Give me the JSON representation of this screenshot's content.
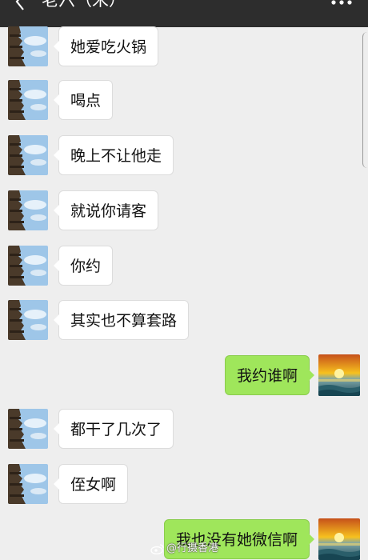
{
  "header": {
    "title": "老六（宋）",
    "back_icon": "chevron-left-icon",
    "more_icon": "more-dots-icon",
    "background": "#2d2d2d"
  },
  "messages": [
    {
      "side": "left",
      "text": "她爱吃火锅"
    },
    {
      "side": "left",
      "text": "喝点"
    },
    {
      "side": "left",
      "text": "晚上不让他走"
    },
    {
      "side": "left",
      "text": "就说你请客"
    },
    {
      "side": "left",
      "text": "你约"
    },
    {
      "side": "left",
      "text": "其实也不算套路"
    },
    {
      "side": "right",
      "text": "我约谁啊"
    },
    {
      "side": "left",
      "text": "都干了几次了"
    },
    {
      "side": "left",
      "text": "侄女啊"
    },
    {
      "side": "right",
      "text": "我也没有她微信啊"
    }
  ],
  "colors": {
    "sent_bubble": "#9fe65b",
    "received_bubble": "#ffffff",
    "chat_background": "#eeeeee"
  },
  "watermark": {
    "text": "@行摄香港",
    "icon": "weibo-icon"
  }
}
